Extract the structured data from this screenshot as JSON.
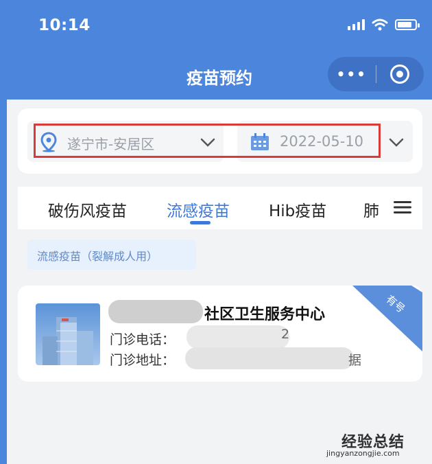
{
  "status_bar": {
    "time": "10:14"
  },
  "nav": {
    "title": "疫苗预约",
    "more_label": "•••"
  },
  "filters": {
    "location": "遂宁市-安居区",
    "date": "2022-05-10"
  },
  "tabs": [
    {
      "label": "破伤风疫苗",
      "active": false
    },
    {
      "label": "流感疫苗",
      "active": true
    },
    {
      "label": "Hib疫苗",
      "active": false
    },
    {
      "label": "肺",
      "active": false
    }
  ],
  "chip": {
    "label": "流感疫苗（裂解成人用）"
  },
  "center": {
    "name_visible": "社区卫生服务中心",
    "phone_label": "门诊电话：",
    "phone_tail": "2",
    "address_label": "门诊地址：",
    "address_tail": "据",
    "badge": "有号"
  },
  "watermark": {
    "cn": "经验总结",
    "url": "jingyanzongjie.com"
  },
  "colors": {
    "brand_blue": "#4b86dc",
    "active_tab": "#3d79d8",
    "highlight_red": "#d93a3a"
  },
  "icons": [
    "signal-icon",
    "wifi-icon",
    "battery-icon",
    "more-dots-icon",
    "target-icon",
    "location-pin-icon",
    "chevron-down-icon",
    "calendar-icon",
    "menu-icon",
    "building-image"
  ]
}
